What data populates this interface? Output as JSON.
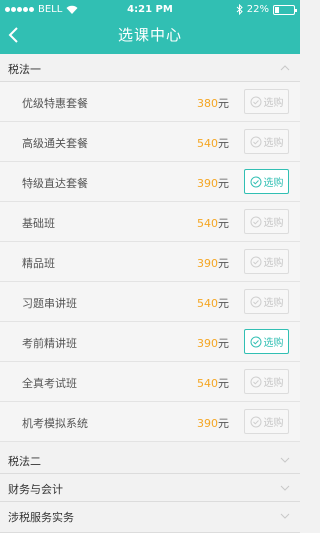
{
  "status_bar": {
    "carrier": "BELL",
    "time": "4:21 PM",
    "battery": "22%",
    "battery_level": 0.22
  },
  "header": {
    "title": "选课中心"
  },
  "sections": [
    {
      "title": "税法一",
      "expanded": true
    },
    {
      "title": "税法二",
      "expanded": false
    },
    {
      "title": "财务与会计",
      "expanded": false
    },
    {
      "title": "涉税服务实务",
      "expanded": false
    }
  ],
  "courses": [
    {
      "name": "优级特惠套餐",
      "price": "380",
      "unit": "元",
      "button": "选购",
      "active": false
    },
    {
      "name": "高级通关套餐",
      "price": "540",
      "unit": "元",
      "button": "选购",
      "active": false
    },
    {
      "name": "特级直达套餐",
      "price": "390",
      "unit": "元",
      "button": "选购",
      "active": true
    },
    {
      "name": "基础班",
      "price": "540",
      "unit": "元",
      "button": "选购",
      "active": false
    },
    {
      "name": "精品班",
      "price": "390",
      "unit": "元",
      "button": "选购",
      "active": false
    },
    {
      "name": "习题串讲班",
      "price": "540",
      "unit": "元",
      "button": "选购",
      "active": false
    },
    {
      "name": "考前精讲班",
      "price": "390",
      "unit": "元",
      "button": "选购",
      "active": true
    },
    {
      "name": "全真考试班",
      "price": "540",
      "unit": "元",
      "button": "选购",
      "active": false
    },
    {
      "name": "机考模拟系统",
      "price": "390",
      "unit": "元",
      "button": "选购",
      "active": false
    }
  ]
}
